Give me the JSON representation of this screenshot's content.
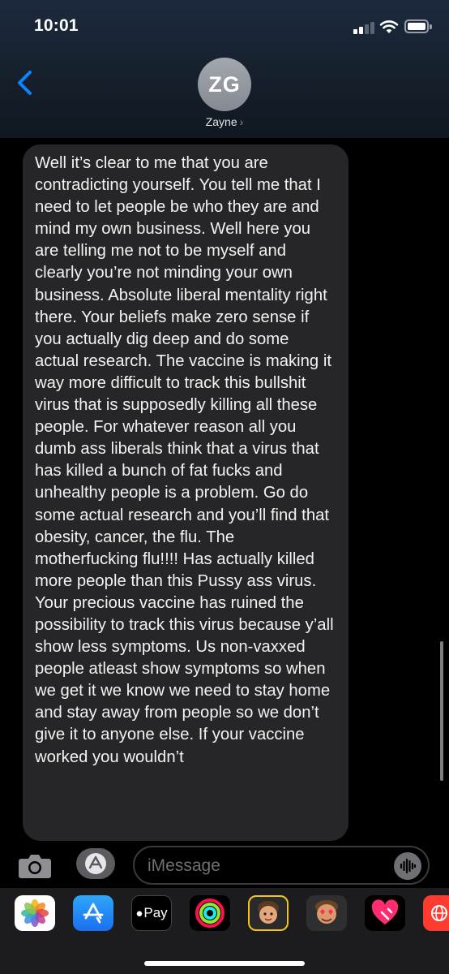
{
  "status_bar": {
    "time": "10:01"
  },
  "contact": {
    "initials": "ZG",
    "name": "Zayne"
  },
  "message": {
    "text": "Well it’s clear to me that you are contradicting yourself. You tell me that I need to let people be who they are and mind my own business. Well here you are telling me not to be myself and clearly you’re not minding your own business. Absolute liberal mentality right there. Your beliefs make zero sense if you actually dig deep and do some actual research. The vaccine is making it way more difficult to track this bullshit virus that is supposedly killing all these people. For whatever reason all you dumb ass liberals think that a virus that has killed a bunch of fat fucks and unhealthy people is a problem. Go do some actual research and you’ll find that obesity, cancer, the flu. The motherfucking flu!!!! Has actually killed more people than this Pussy ass virus. Your precious vaccine has ruined the possibility to track this virus because y’all show less symptoms. Us non-vaxxed people atleast show symptoms so when we get it we know we need to stay home and stay away from people so we don’t give it to anyone else. If your vaccine worked you wouldn’t"
  },
  "composer": {
    "placeholder": "iMessage"
  },
  "app_tray": {
    "items": [
      {
        "name": "Photos",
        "icon": "photos-icon"
      },
      {
        "name": "App Store",
        "icon": "app-store-icon"
      },
      {
        "name": "Apple Pay",
        "icon": "apple-pay-icon",
        "label": "Pay"
      },
      {
        "name": "Activity",
        "icon": "activity-rings-icon"
      },
      {
        "name": "Memoji",
        "icon": "memoji-icon"
      },
      {
        "name": "Memoji Stickers",
        "icon": "memoji-stickers-icon"
      },
      {
        "name": "Digital Touch",
        "icon": "digital-touch-icon"
      },
      {
        "name": "Web",
        "icon": "globe-icon"
      }
    ]
  },
  "colors": {
    "accent": "#0a84ff",
    "bubble": "#262628",
    "background": "#000000"
  }
}
